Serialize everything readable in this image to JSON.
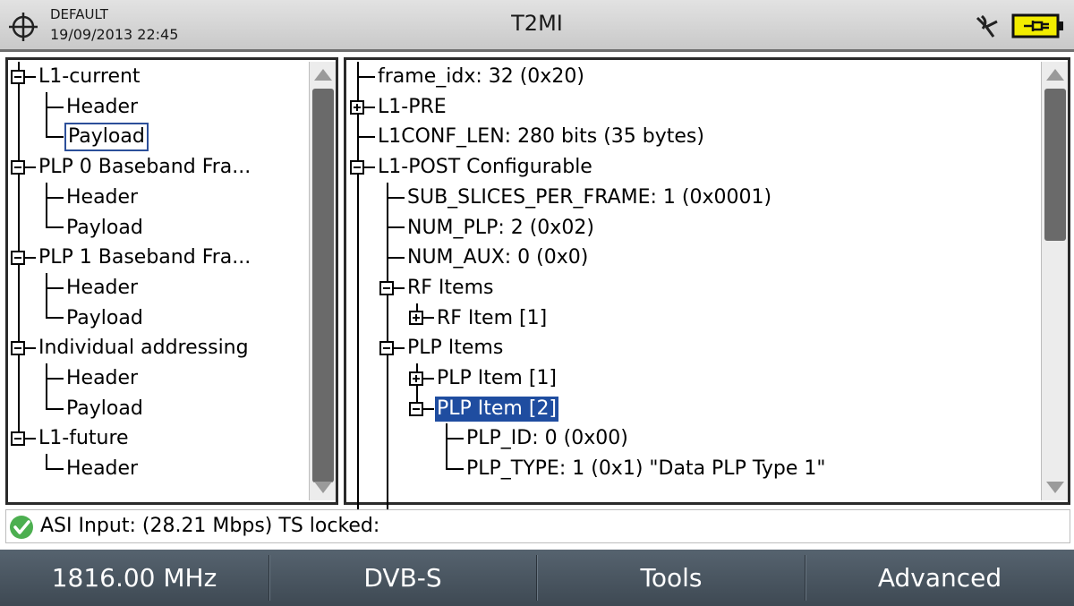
{
  "header": {
    "preset": "DEFAULT",
    "datetime": "19/09/2013 22:45",
    "title": "T2MI",
    "icons": [
      "crosshair-icon",
      "satellite-icon",
      "battery-plug-icon"
    ]
  },
  "left_tree": {
    "items": [
      {
        "label": "L1-current",
        "level": 0,
        "expander": "minus"
      },
      {
        "label": "Header",
        "level": 1
      },
      {
        "label": "Payload",
        "level": 1,
        "selected": true
      },
      {
        "label": "PLP 0 Baseband Fra...",
        "level": 0,
        "expander": "minus"
      },
      {
        "label": "Header",
        "level": 1
      },
      {
        "label": "Payload",
        "level": 1
      },
      {
        "label": "PLP 1 Baseband Fra...",
        "level": 0,
        "expander": "minus"
      },
      {
        "label": "Header",
        "level": 1
      },
      {
        "label": "Payload",
        "level": 1
      },
      {
        "label": "Individual addressing",
        "level": 0,
        "expander": "minus"
      },
      {
        "label": "Header",
        "level": 1
      },
      {
        "label": "Payload",
        "level": 1
      },
      {
        "label": "L1-future",
        "level": 0,
        "expander": "minus"
      },
      {
        "label": "Header",
        "level": 1
      }
    ]
  },
  "right_tree": {
    "items": [
      {
        "label": "frame_idx: 32 (0x20)",
        "level": 0
      },
      {
        "label": "L1-PRE",
        "level": 0,
        "expander": "plus"
      },
      {
        "label": "L1CONF_LEN: 280 bits (35 bytes)",
        "level": 0
      },
      {
        "label": "L1-POST Configurable",
        "level": 0,
        "expander": "minus"
      },
      {
        "label": "SUB_SLICES_PER_FRAME: 1 (0x0001)",
        "level": 1
      },
      {
        "label": "NUM_PLP: 2 (0x02)",
        "level": 1
      },
      {
        "label": "NUM_AUX: 0 (0x0)",
        "level": 1
      },
      {
        "label": "RF Items",
        "level": 1,
        "expander": "minus"
      },
      {
        "label": "RF Item [1]",
        "level": 2,
        "expander": "plus"
      },
      {
        "label": "PLP Items",
        "level": 1,
        "expander": "minus"
      },
      {
        "label": "PLP Item [1]",
        "level": 2,
        "expander": "plus"
      },
      {
        "label": "PLP Item [2]",
        "level": 2,
        "expander": "minus",
        "selected": true
      },
      {
        "label": "PLP_ID: 0 (0x00)",
        "level": 3
      },
      {
        "label": "PLP_TYPE: 1 (0x1) \"Data PLP Type 1\"",
        "level": 3
      }
    ]
  },
  "status": {
    "icon": "check-ok-icon",
    "text": "ASI Input: (28.21 Mbps) TS locked:"
  },
  "softkeys": [
    {
      "label": "1816.00 MHz"
    },
    {
      "label": "DVB-S"
    },
    {
      "label": "Tools"
    },
    {
      "label": "Advanced"
    }
  ],
  "colors": {
    "selection": "#1f4da0",
    "softkey_bg": "#4a5661",
    "status_ok": "#4caf50"
  }
}
